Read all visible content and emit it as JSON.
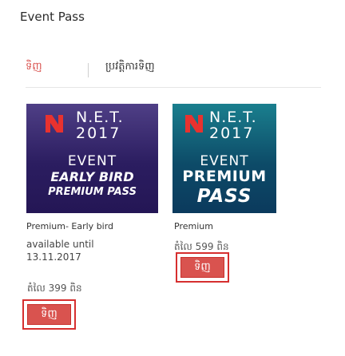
{
  "page": {
    "title": "Event Pass"
  },
  "tabs": [
    {
      "label": "ទិញ",
      "active": true
    },
    {
      "label": "ប្រវត្តិការទិញ",
      "active": false
    }
  ],
  "cards": [
    {
      "image": {
        "logo_line1": "N.E.T.",
        "logo_line2": "2017",
        "event": "EVENT",
        "promo_line1": "EARLY BIRD",
        "promo_line2": "PREMIUM PASS"
      },
      "name": "Premium- Early bird",
      "available_line1": "available until",
      "available_line2": "13.11.2017",
      "price": "តំលៃ 399 ពិន",
      "buy_label": "ទិញ"
    },
    {
      "image": {
        "logo_line1": "N.E.T.",
        "logo_line2": "2017",
        "event": "EVENT",
        "promo_line1": "PREMIUM",
        "promo_line2": "PASS"
      },
      "name": "Premium",
      "price": "តំលៃ 599 ពិន",
      "buy_label": "ទិញ"
    }
  ],
  "colors": {
    "accent": "#d9534f",
    "frame": "#d62f2f",
    "card1_bg": "#2b1d60",
    "card2_bg": "#0d4b68"
  },
  "icons": {
    "logo": "net-logo-icon"
  }
}
